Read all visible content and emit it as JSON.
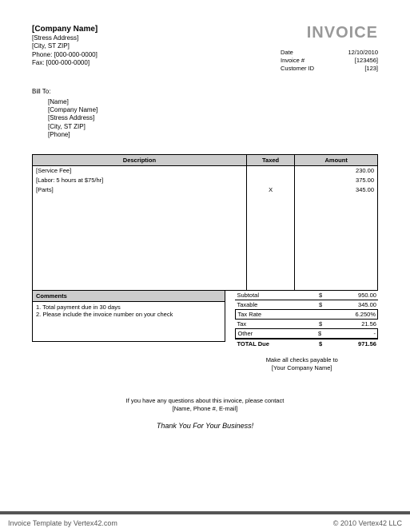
{
  "header": {
    "company_name": "[Company Name]",
    "address": "[Stress Address]",
    "city": "[City, ST  ZIP]",
    "phone": "Phone: [000-000-0000]",
    "fax": "Fax: [000-000-0000]",
    "invoice_title": "INVOICE",
    "meta": {
      "date_label": "Date",
      "date_value": "12/10/2010",
      "invoice_label": "Invoice #",
      "invoice_value": "[123456]",
      "customer_label": "Customer ID",
      "customer_value": "[123]"
    }
  },
  "billto": {
    "label": "Bill To:",
    "name": "[Name]",
    "company": "[Company Name]",
    "address": "[Stress Address]",
    "city": "[City, ST  ZIP]",
    "phone": "[Phone]"
  },
  "table": {
    "headers": {
      "desc": "Description",
      "taxed": "Taxed",
      "amount": "Amount"
    },
    "rows": [
      {
        "desc": "[Service Fee]",
        "taxed": "",
        "amount": "230.00"
      },
      {
        "desc": "[Labor: 5 hours at $75/hr]",
        "taxed": "",
        "amount": "375.00"
      },
      {
        "desc": "[Parts]",
        "taxed": "X",
        "amount": "345.00"
      }
    ]
  },
  "comments": {
    "header": "Comments",
    "line1": "1. Total payment due in 30 days",
    "line2": "2. Please include the invoice number on your check"
  },
  "totals": {
    "subtotal_label": "Subtotal",
    "subtotal_cur": "$",
    "subtotal_val": "950.00",
    "taxable_label": "Taxable",
    "taxable_cur": "$",
    "taxable_val": "345.00",
    "taxrate_label": "Tax Rate",
    "taxrate_val": "6.250%",
    "tax_label": "Tax",
    "tax_cur": "$",
    "tax_val": "21.56",
    "other_label": "Other",
    "other_cur": "$",
    "other_val": "-",
    "grand_label": "TOTAL Due",
    "grand_cur": "$",
    "grand_val": "971.56"
  },
  "payable": {
    "line1": "Make all checks payable to",
    "line2": "[Your Company Name]"
  },
  "contact": {
    "line1": "If you have any questions about this invoice, please contact",
    "line2": "[Name, Phone #, E-mail]"
  },
  "thanks": "Thank You For Your Business!",
  "footer": {
    "left": "Invoice Template by Vertex42.com",
    "right": "© 2010 Vertex42 LLC"
  }
}
